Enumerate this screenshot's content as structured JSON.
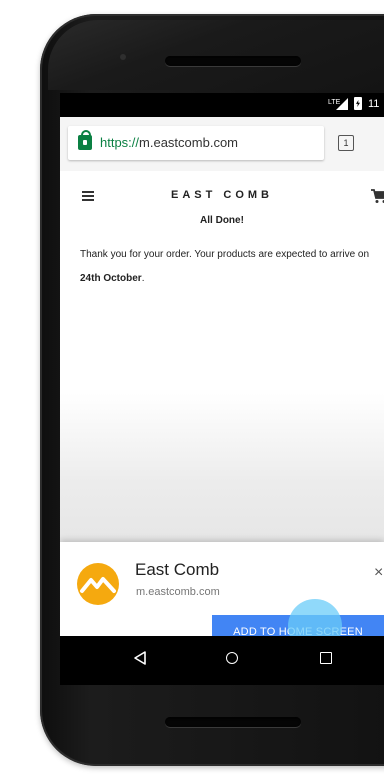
{
  "status_bar": {
    "network": "LTE",
    "time": "11"
  },
  "browser": {
    "url_scheme": "https://",
    "url_host": "m.eastcomb.com",
    "tab_count": "1"
  },
  "site": {
    "brand": "EAST COMB",
    "heading": "All Done!",
    "message_prefix": "Thank you for your order. Your products are expected to arrive on ",
    "delivery_date": "24th October",
    "message_suffix": "."
  },
  "banner": {
    "app_name": "East Comb",
    "app_url": "m.eastcomb.com",
    "close_symbol": "×",
    "add_button_label": "ADD TO HOME SCREEN"
  },
  "icons": {
    "lock": "lock-icon",
    "menu": "hamburger-icon",
    "cart": "cart-icon",
    "close": "close-icon",
    "back": "back-icon",
    "home": "home-icon",
    "recents": "recents-icon",
    "logo": "mountain-logo-icon"
  },
  "colors": {
    "secure_green": "#0b8043",
    "button_blue": "#4285f4",
    "logo_yellow": "#f5a90f",
    "ripple": "#6bccf8"
  }
}
